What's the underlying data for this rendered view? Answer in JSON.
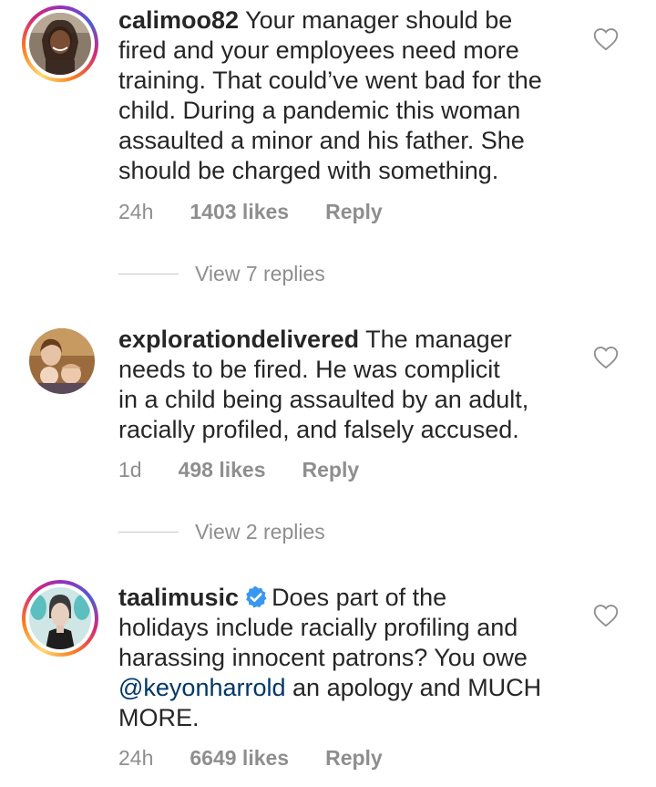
{
  "comments": [
    {
      "username": "calimoo82",
      "text": "Your manager should be fired and your employees need more training. That could’ve went bad for the child. During a pandemic this woman assaulted a minor and his father. She should be charged with something.",
      "lines": [
        "Your manager should be",
        "fired and your employees need more",
        "training. That could’ve went bad for the",
        "child. During a pandemic this woman",
        "assaulted a minor and his father. She",
        "should be charged with something."
      ],
      "time": "24h",
      "likes": "1403 likes",
      "reply_label": "Reply",
      "view_replies": "View 7 replies",
      "has_story": true,
      "verified": false
    },
    {
      "username": "explorationdelivered",
      "lines": [
        "The manager",
        "needs to be fired. He was complicit",
        "in a child being assaulted by an adult,",
        "racially profiled, and falsely accused."
      ],
      "time": "1d",
      "likes": "498 likes",
      "reply_label": "Reply",
      "view_replies": "View 2 replies",
      "has_story": false,
      "verified": false
    },
    {
      "username": "taalimusic",
      "lines": [
        "Does part of the",
        "holidays include racially profiling and",
        "harassing innocent patrons? You owe",
        "an apology and MUCH",
        "MORE."
      ],
      "mention": "@keyonharrold",
      "time": "24h",
      "likes": "6649 likes",
      "reply_label": "Reply",
      "has_story": true,
      "verified": true
    }
  ],
  "icons": {
    "like": "heart-outline-icon",
    "verified": "verified-badge-icon"
  },
  "colors": {
    "text": "#262626",
    "secondary": "#8e8e8e",
    "mention": "#00376b",
    "verified": "#3897f0"
  }
}
